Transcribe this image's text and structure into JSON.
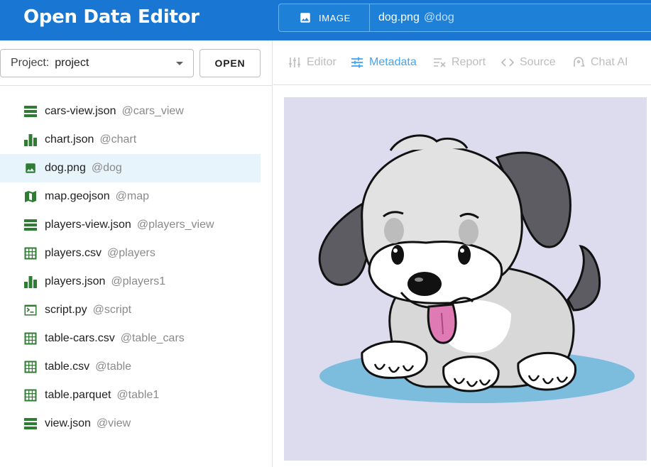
{
  "app": {
    "title": "Open Data Editor"
  },
  "header": {
    "file_type_label": "IMAGE",
    "file_name": "dog.png",
    "file_alias": "@dog"
  },
  "sidebar": {
    "project_label": "Project:",
    "project_value": "project",
    "open_label": "OPEN",
    "files": [
      {
        "name": "cars-view.json",
        "alias": "@cars_view",
        "icon": "view-icon"
      },
      {
        "name": "chart.json",
        "alias": "@chart",
        "icon": "chart-icon"
      },
      {
        "name": "dog.png",
        "alias": "@dog",
        "icon": "image-icon",
        "selected": true
      },
      {
        "name": "map.geojson",
        "alias": "@map",
        "icon": "map-icon"
      },
      {
        "name": "players-view.json",
        "alias": "@players_view",
        "icon": "view-icon"
      },
      {
        "name": "players.csv",
        "alias": "@players",
        "icon": "table-icon"
      },
      {
        "name": "players.json",
        "alias": "@players1",
        "icon": "chart-icon"
      },
      {
        "name": "script.py",
        "alias": "@script",
        "icon": "terminal-icon"
      },
      {
        "name": "table-cars.csv",
        "alias": "@table_cars",
        "icon": "table-icon"
      },
      {
        "name": "table.csv",
        "alias": "@table",
        "icon": "table-icon"
      },
      {
        "name": "table.parquet",
        "alias": "@table1",
        "icon": "table-icon"
      },
      {
        "name": "view.json",
        "alias": "@view",
        "icon": "view-icon"
      }
    ]
  },
  "toolbar": {
    "tabs": [
      {
        "label": "Editor",
        "icon": "editor-icon",
        "active": false
      },
      {
        "label": "Metadata",
        "icon": "tune-icon",
        "active": true
      },
      {
        "label": "Report",
        "icon": "report-icon",
        "active": false
      },
      {
        "label": "Source",
        "icon": "code-icon",
        "active": false
      },
      {
        "label": "Chat AI",
        "icon": "chat-ai-icon",
        "active": false
      }
    ]
  },
  "colors": {
    "header": "#1976d2",
    "accent": "#42a5f5",
    "file_icon": "#2e7d32",
    "selected_row": "#e8f4fb",
    "preview_bg": "#dddcef"
  }
}
